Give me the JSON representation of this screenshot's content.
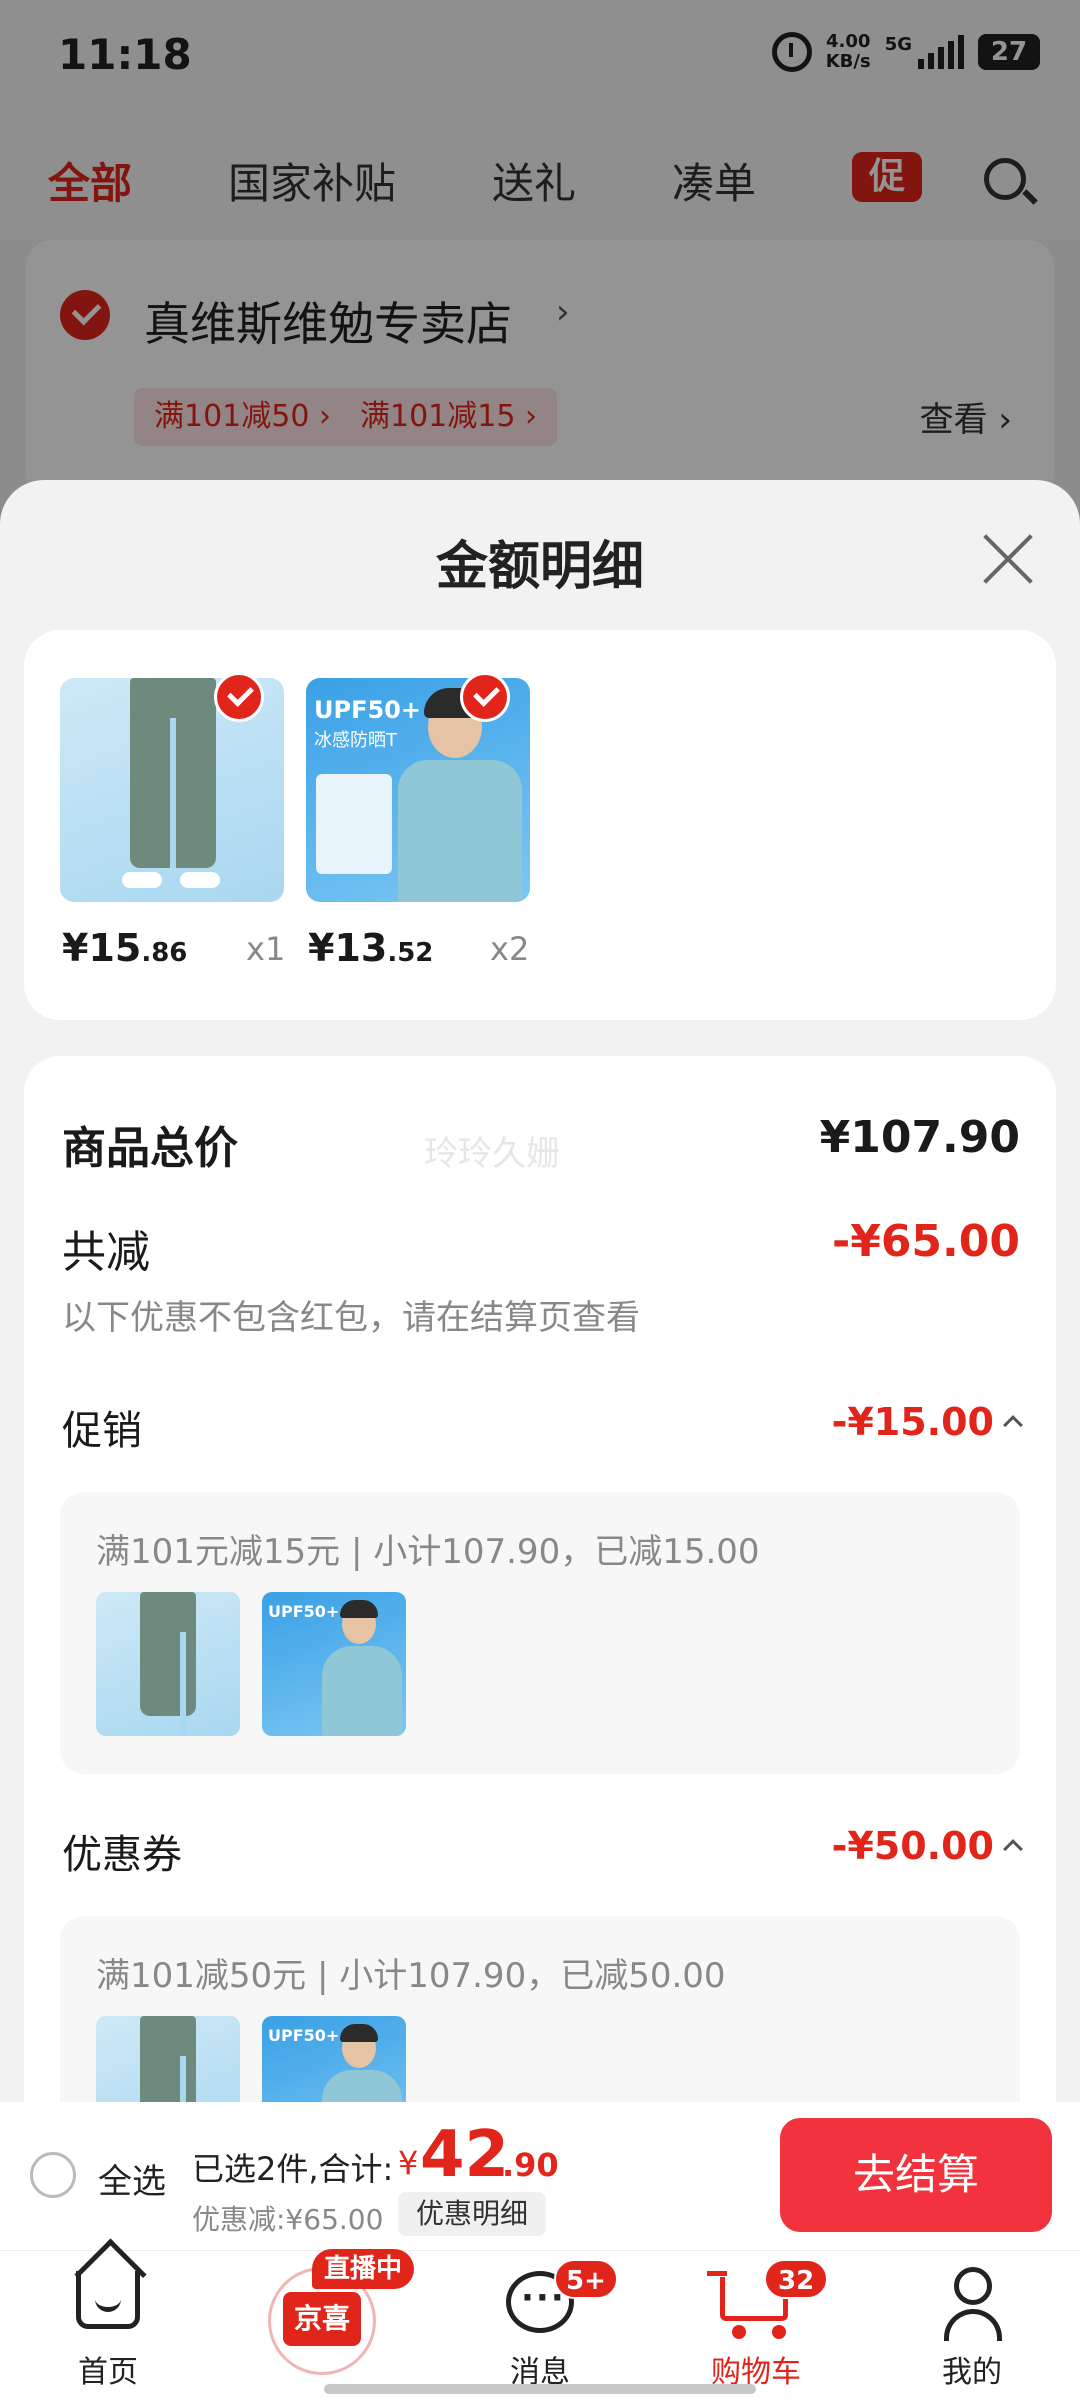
{
  "status_bar": {
    "time": "11:18",
    "net_speed_value": "4.00",
    "net_speed_unit": "KB/s",
    "network": "5G",
    "battery": "27"
  },
  "top_nav": {
    "tabs": [
      "全部",
      "国家补贴",
      "送礼",
      "凑单"
    ],
    "promo_badge": "促"
  },
  "store": {
    "name": "真维斯维勉专卖店",
    "coupons": [
      "满101减50 ›",
      "满101减15 ›"
    ],
    "view_label": "查看 ›"
  },
  "sheet": {
    "title": "金额明细",
    "items": [
      {
        "price_int": "¥15",
        "price_dec": ".86",
        "qty": "x1",
        "icon": "pants-product"
      },
      {
        "price_int": "¥13",
        "price_dec": ".52",
        "qty": "x2",
        "icon": "tshirt-product",
        "thumb_text_1": "UPF50+",
        "thumb_text_2": "冰感防晒T"
      }
    ],
    "watermark": "玲玲久姗",
    "total_label": "商品总价",
    "total_value": "¥107.90",
    "reduce_label": "共减",
    "reduce_value": "-¥65.00",
    "reduce_note": "以下优惠不包含红包，请在结算页查看",
    "promo": {
      "label": "促销",
      "value": "-¥15.00",
      "detail": "满101元减15元 | 小计107.90，已减15.00"
    },
    "coupon": {
      "label": "优惠券",
      "value": "-¥50.00",
      "detail": "满101减50元 | 小计107.90，已减50.00"
    }
  },
  "checkout": {
    "select_all": "全选",
    "selected_text": "已选2件,合计:",
    "total_symbol": "¥",
    "total_int": "42",
    "total_dec": ".90",
    "discount_text": "优惠减:¥65.00",
    "discount_detail_btn": "优惠明细",
    "pay_button": "去结算"
  },
  "tab_bar": {
    "items": [
      {
        "label": "首页",
        "icon": "home-icon"
      },
      {
        "label": "京喜",
        "icon": "jingxi-icon",
        "badge": "直播中"
      },
      {
        "label": "消息",
        "icon": "message-icon",
        "badge": "5+"
      },
      {
        "label": "购物车",
        "icon": "cart-icon",
        "badge": "32",
        "active": true
      },
      {
        "label": "我的",
        "icon": "user-icon"
      }
    ]
  },
  "colors": {
    "accent_red": "#e1251b",
    "pay_button": "#f2323c"
  }
}
